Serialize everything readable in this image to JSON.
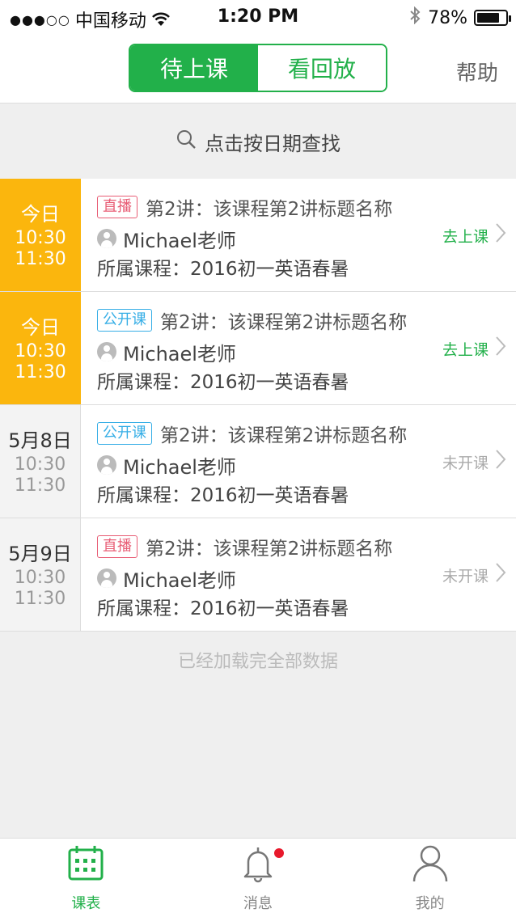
{
  "status_bar": {
    "signal": "●●●○○",
    "carrier": "中国移动",
    "time": "1:20 PM",
    "battery": "78%",
    "battery_level": 0.78
  },
  "header": {
    "tabs": [
      {
        "label": "待上课",
        "active": true
      },
      {
        "label": "看回放",
        "active": false
      }
    ],
    "help_label": "帮助"
  },
  "search": {
    "label": "点击按日期查找"
  },
  "lessons": [
    {
      "date": "今日",
      "start": "10:30",
      "end": "11:30",
      "tag": "直播",
      "tag_type": "live",
      "title": "第2讲：该课程第2讲标题名称",
      "teacher": "Michael老师",
      "course": "所属课程：2016初一英语春暑",
      "action": "去上课",
      "action_type": "go"
    },
    {
      "date": "今日",
      "start": "10:30",
      "end": "11:30",
      "tag": "公开课",
      "tag_type": "open",
      "title": "第2讲：该课程第2讲标题名称",
      "teacher": "Michael老师",
      "course": "所属课程：2016初一英语春暑",
      "action": "去上课",
      "action_type": "go"
    },
    {
      "date": "5月8日",
      "start": "10:30",
      "end": "11:30",
      "tag": "公开课",
      "tag_type": "open",
      "title": "第2讲：该课程第2讲标题名称",
      "teacher": "Michael老师",
      "course": "所属课程：2016初一英语春暑",
      "action": "未开课",
      "action_type": "not"
    },
    {
      "date": "5月9日",
      "start": "10:30",
      "end": "11:30",
      "tag": "直播",
      "tag_type": "live",
      "title": "第2讲：该课程第2讲标题名称",
      "teacher": "Michael老师",
      "course": "所属课程：2016初一英语春暑",
      "action": "未开课",
      "action_type": "not"
    }
  ],
  "footer_note": "已经加载完全部数据",
  "tabbar": {
    "items": [
      {
        "label": "课表",
        "icon": "calendar-icon",
        "active": true
      },
      {
        "label": "消息",
        "icon": "bell-icon",
        "active": false
      },
      {
        "label": "我的",
        "icon": "person-icon",
        "active": false
      }
    ]
  },
  "colors": {
    "accent": "#22b04a",
    "today": "#fbb60d",
    "live_tag": "#e85d75",
    "open_tag": "#36aee6"
  }
}
